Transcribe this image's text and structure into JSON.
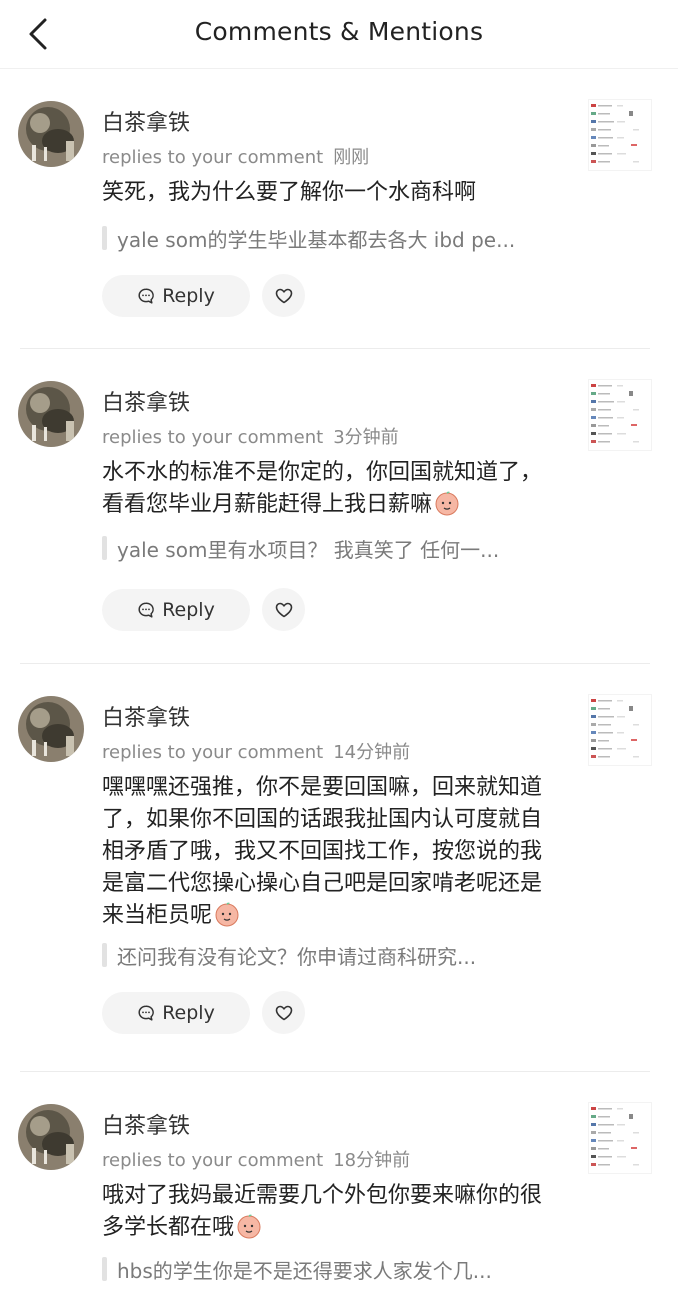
{
  "header": {
    "title": "Comments & Mentions",
    "back_icon": "chevron-left-icon"
  },
  "comments": [
    {
      "user": "白茶拿铁",
      "action": "replies to your comment",
      "time": "刚刚",
      "text": "笑死，我为什么要了解你一个水商科啊",
      "quote": "yale som的学生毕业基本都去各大 ibd pe...",
      "reply_label": "Reply"
    },
    {
      "user": "白茶拿铁",
      "action": "replies to your comment",
      "time": "3分钟前",
      "text": "水不水的标准不是你定的，你回国就知道了，看看您毕业月薪能赶得上我日薪嘛",
      "quote": "yale som里有水项目？ 我真笑了 任何一...",
      "reply_label": "Reply"
    },
    {
      "user": "白茶拿铁",
      "action": "replies to your comment",
      "time": "14分钟前",
      "text": "嘿嘿嘿还强推，你不是要回国嘛，回来就知道了，如果你不回国的话跟我扯国内认可度就自相矛盾了哦，我又不回国找工作，按您说的我是富二代您操心操心自己吧是回家啃老呢还是来当柜员呢",
      "quote": "还问我有没有论文？你申请过商科研究...",
      "reply_label": "Reply"
    },
    {
      "user": "白茶拿铁",
      "action": "replies to your comment",
      "time": "18分钟前",
      "text": "哦对了我妈最近需要几个外包你要来嘛你的很多学长都在哦",
      "quote": "hbs的学生你是不是还得要求人家发个几...",
      "reply_label": "Reply"
    }
  ],
  "colors": {
    "background": "#ffffff",
    "secondary_text": "#8a8a8a",
    "button_bg": "#f4f4f4"
  }
}
